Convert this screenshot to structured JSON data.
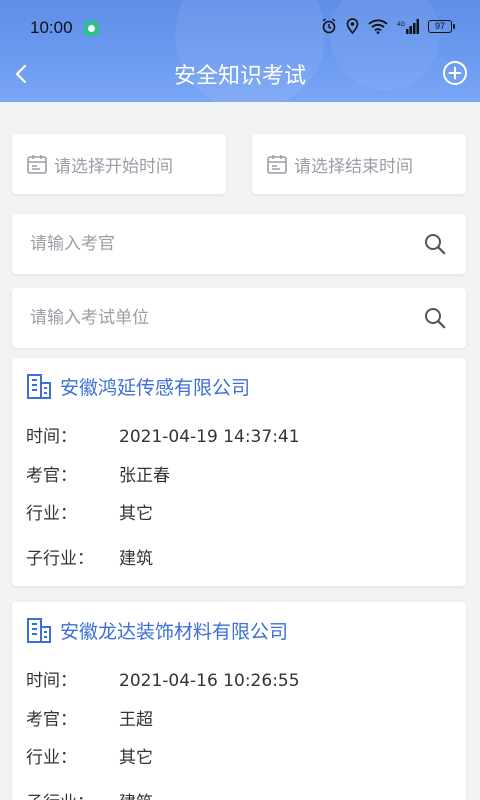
{
  "status_bar": {
    "time": "10:00",
    "battery": "97"
  },
  "nav": {
    "title": "安全知识考试"
  },
  "filters": {
    "start_placeholder": "请选择开始时间",
    "end_placeholder": "请选择结束时间",
    "examiner_placeholder": "请输入考官",
    "unit_placeholder": "请输入考试单位"
  },
  "labels": {
    "time": "时间：",
    "examiner": "考官：",
    "industry": "行业：",
    "sub_industry": "子行业："
  },
  "records": [
    {
      "company": "安徽鸿延传感有限公司",
      "time": "2021-04-19 14:37:41",
      "examiner": "张正春",
      "industry": "其它",
      "sub_industry": "建筑"
    },
    {
      "company": "安徽龙达装饰材料有限公司",
      "time": "2021-04-16 10:26:55",
      "examiner": "王超",
      "industry": "其它",
      "sub_industry": "建筑"
    }
  ],
  "colors": {
    "header": "#6b9af0",
    "accent": "#3d6fdb",
    "background": "#f2f3f5"
  }
}
